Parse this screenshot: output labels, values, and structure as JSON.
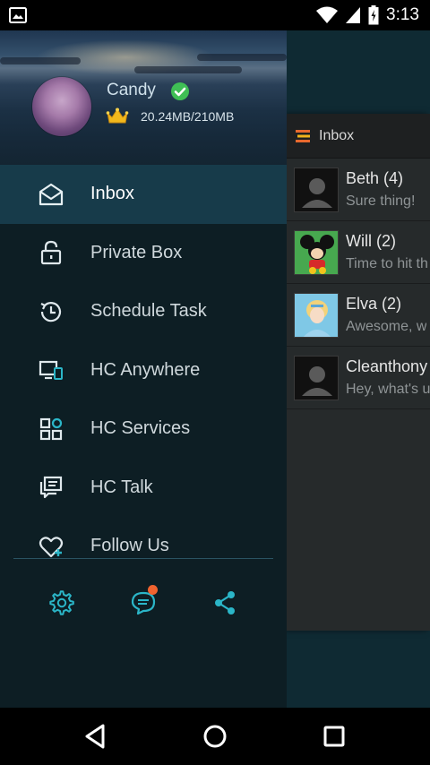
{
  "status_bar": {
    "time": "3:13",
    "icons": [
      "image-notification-icon",
      "wifi-icon",
      "signal-icon",
      "battery-icon"
    ]
  },
  "drawer": {
    "user": {
      "name": "Candy",
      "storage": "20.24MB/210MB",
      "verified_color": "#3fbf55",
      "crown_color": "#f2b81c"
    },
    "menu": [
      {
        "label": "Inbox",
        "icon": "envelope-open-icon",
        "active": true
      },
      {
        "label": "Private Box",
        "icon": "lock-icon",
        "active": false
      },
      {
        "label": "Schedule Task",
        "icon": "history-clock-icon",
        "active": false
      },
      {
        "label": "HC Anywhere",
        "icon": "devices-icon",
        "active": false
      },
      {
        "label": "HC Services",
        "icon": "grid-icon",
        "active": false
      },
      {
        "label": "HC Talk",
        "icon": "chat-window-icon",
        "active": false
      },
      {
        "label": "Follow Us",
        "icon": "heart-plus-icon",
        "active": false
      }
    ],
    "bottom_actions": [
      "settings-icon",
      "feedback-icon",
      "share-icon"
    ],
    "accent_color": "#2bb6c8"
  },
  "inbox": {
    "title": "Inbox",
    "conversations": [
      {
        "name": "Beth (4)",
        "preview": "Sure thing!",
        "avatar": "default"
      },
      {
        "name": "Will (2)",
        "preview": "Time to hit th",
        "avatar": "mickey"
      },
      {
        "name": "Elva (2)",
        "preview": "Awesome, w",
        "avatar": "cinderella"
      },
      {
        "name": "Cleanthony",
        "preview": "Hey, what's u",
        "avatar": "default"
      }
    ]
  },
  "nav_bar": {
    "buttons": [
      "back-icon",
      "home-icon",
      "recents-icon"
    ]
  }
}
